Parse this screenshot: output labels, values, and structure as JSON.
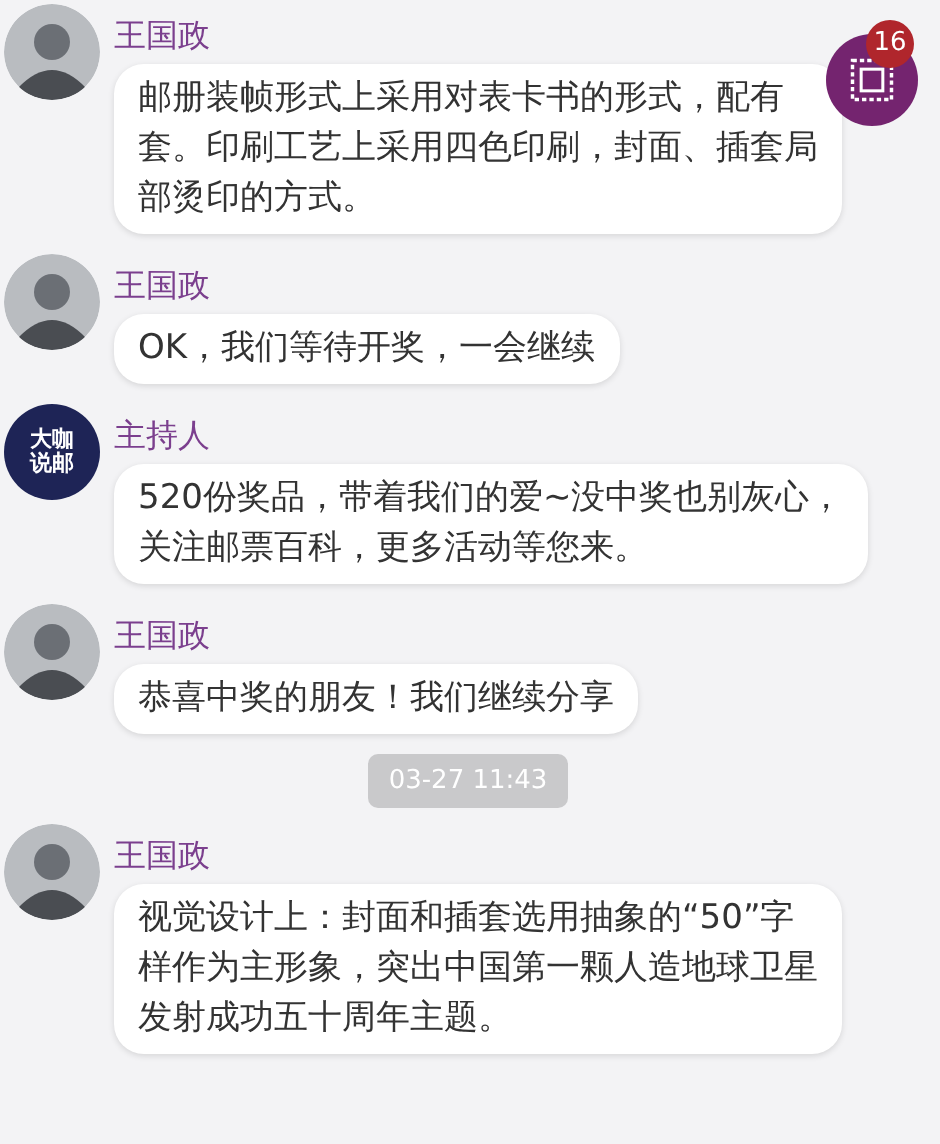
{
  "chat": [
    {
      "kind": "message",
      "avatar": {
        "kind": "person"
      },
      "sender": "王国政",
      "lines": [
        "邮册装帧形式上采用对表卡书的形式，配有",
        "套。印刷工艺上采用四色印刷，封面、插套局",
        "部烫印的方式。"
      ]
    },
    {
      "kind": "message",
      "avatar": {
        "kind": "person"
      },
      "sender": "王国政",
      "lines": [
        "OK，我们等待开奖，一会继续"
      ]
    },
    {
      "kind": "message",
      "avatar": {
        "kind": "logo",
        "text": [
          "大咖",
          "说邮"
        ]
      },
      "sender": "主持人",
      "lines": [
        "520份奖品，带着我们的爱~没中奖也别灰心，",
        "关注邮票百科，更多活动等您来。"
      ]
    },
    {
      "kind": "message",
      "avatar": {
        "kind": "person"
      },
      "sender": "王国政",
      "lines": [
        "恭喜中奖的朋友！我们继续分享"
      ]
    },
    {
      "kind": "timestamp",
      "text": "03-27 11:43"
    },
    {
      "kind": "message",
      "avatar": {
        "kind": "person"
      },
      "sender": "王国政",
      "lines": [
        "视觉设计上：封面和插套选用抽象的“50”字",
        "样作为主形象，突出中国第一颗人造地球卫星",
        "发射成功五十周年主题。"
      ]
    }
  ],
  "floating_button": {
    "badge": "16"
  }
}
